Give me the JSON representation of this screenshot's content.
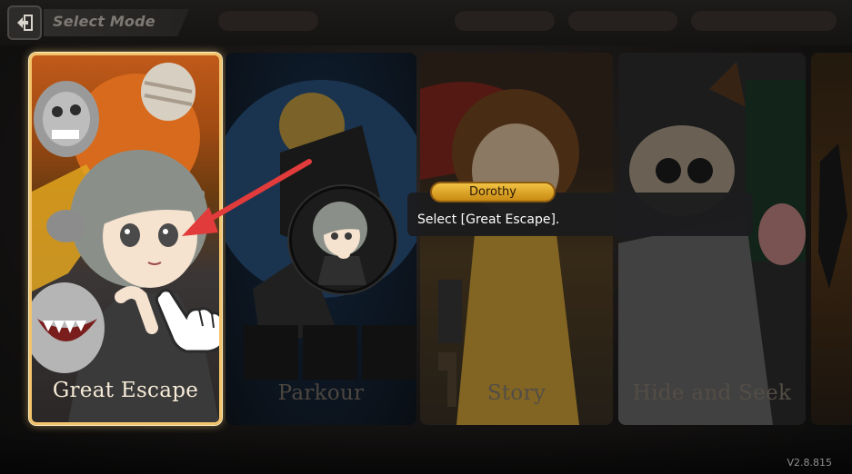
{
  "header": {
    "title": "Select Mode",
    "back_icon": "back-arrow-icon"
  },
  "modes": [
    {
      "label": "Great Escape",
      "selected": true
    },
    {
      "label": "Parkour",
      "selected": false
    },
    {
      "label": "Story",
      "selected": false
    },
    {
      "label": "Hide and Seek",
      "selected": false
    }
  ],
  "tutorial": {
    "speaker": "Dorothy",
    "message": "Select [Great Escape]."
  },
  "footer": {
    "version": "V2.8.815"
  },
  "colors": {
    "highlight_border": "#f3c46c",
    "name_tag": "#e6b12b",
    "arrow": "#e23b3b"
  }
}
